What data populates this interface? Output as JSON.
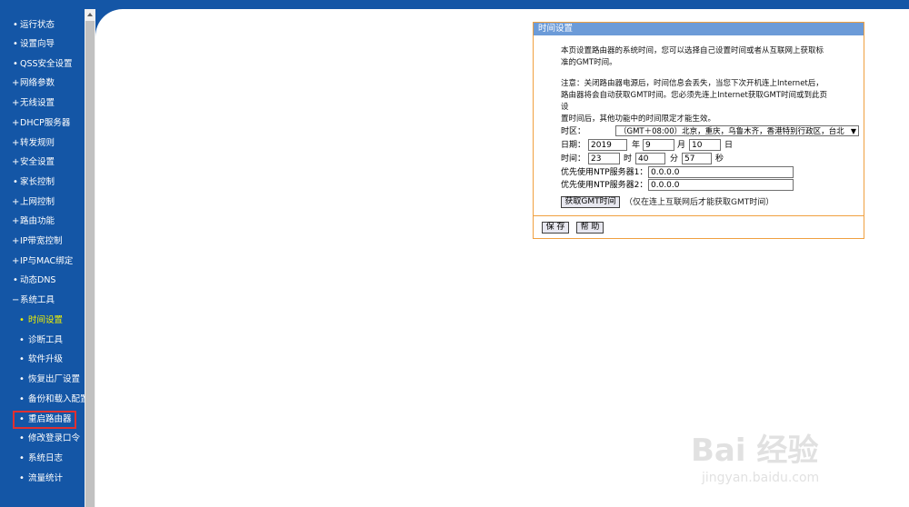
{
  "sidebar": {
    "items": [
      {
        "label": "运行状态",
        "bullet": "•"
      },
      {
        "label": "设置向导",
        "bullet": "•"
      },
      {
        "label": "QSS安全设置",
        "bullet": "•"
      },
      {
        "label": "网络参数",
        "bullet": "+"
      },
      {
        "label": "无线设置",
        "bullet": "+"
      },
      {
        "label": "DHCP服务器",
        "bullet": "+"
      },
      {
        "label": "转发规则",
        "bullet": "+"
      },
      {
        "label": "安全设置",
        "bullet": "+"
      },
      {
        "label": "家长控制",
        "bullet": "•"
      },
      {
        "label": "上网控制",
        "bullet": "+"
      },
      {
        "label": "路由功能",
        "bullet": "+"
      },
      {
        "label": "IP带宽控制",
        "bullet": "+"
      },
      {
        "label": "IP与MAC绑定",
        "bullet": "+"
      },
      {
        "label": "动态DNS",
        "bullet": "•"
      },
      {
        "label": "系统工具",
        "bullet": "−"
      }
    ],
    "subitems": [
      {
        "label": "时间设置",
        "bullet": "•"
      },
      {
        "label": "诊断工具",
        "bullet": "•"
      },
      {
        "label": "软件升级",
        "bullet": "•"
      },
      {
        "label": "恢复出厂设置",
        "bullet": "•"
      },
      {
        "label": "备份和载入配置",
        "bullet": "•"
      },
      {
        "label": "重启路由器",
        "bullet": "•"
      },
      {
        "label": "修改登录口令",
        "bullet": "•"
      },
      {
        "label": "系统日志",
        "bullet": "•"
      },
      {
        "label": "流量统计",
        "bullet": "•"
      }
    ]
  },
  "panel": {
    "title": "时间设置",
    "desc1_line1": "本页设置路由器的系统时间，您可以选择自己设置时间或者从互联网上获取标",
    "desc1_line2": "准的GMT时间。",
    "desc2_line1": "注意：关闭路由器电源后，时间信息会丢失，当您下次开机连上Internet后，",
    "desc2_line2": "路由器将会自动获取GMT时间。您必须先连上Internet获取GMT时间或到此页设",
    "desc2_line3": "置时间后，其他功能中的时间限定才能生效。",
    "timezone_label": "时区：",
    "timezone_value": "（GMT＋08:00）北京，重庆，乌鲁木齐，香港特别行政区，台北",
    "date_label": "日期：",
    "year": "2019",
    "year_unit": "年",
    "month": "9",
    "month_unit": "月",
    "day": "10",
    "day_unit": "日",
    "time_label": "时间：",
    "hour": "23",
    "hour_unit": "时",
    "minute": "40",
    "minute_unit": "分",
    "second": "57",
    "second_unit": "秒",
    "ntp1_label": "优先使用NTP服务器1：",
    "ntp1_value": "0.0.0.0",
    "ntp2_label": "优先使用NTP服务器2：",
    "ntp2_value": "0.0.0.0",
    "get_gmt_button": "获取GMT时间",
    "get_gmt_note": "（仅在连上互联网后才能获取GMT时间）",
    "save_button": "保 存",
    "help_button": "帮 助"
  },
  "watermark": {
    "logo": "Bai 经验",
    "url": "jingyan.baidu.com"
  }
}
